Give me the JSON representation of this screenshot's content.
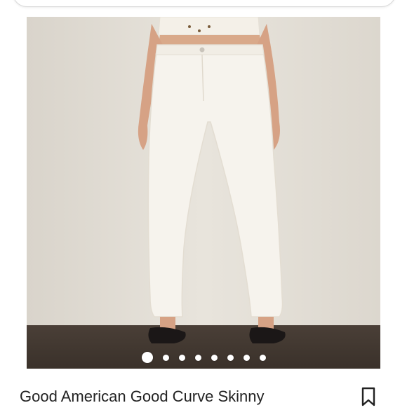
{
  "listing": {
    "title": "Good American Good Curve Skinny",
    "image_count": 8,
    "active_image_index": 0
  },
  "colors": {
    "page_background": "#ffffff",
    "dot_color": "#ffffff",
    "title_color": "#222222"
  },
  "icons": {
    "save": "bookmark-icon"
  }
}
